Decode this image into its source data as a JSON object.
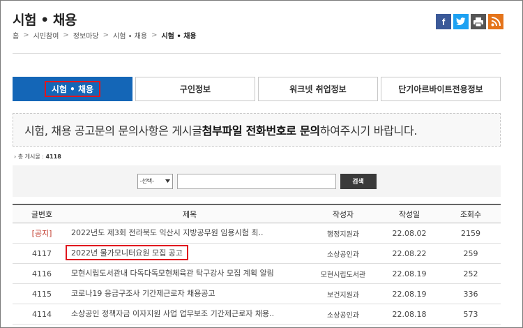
{
  "page": {
    "title": "시험 • 채용"
  },
  "share": {
    "facebook": "f",
    "twitter": "t",
    "print": "⎙",
    "rss": "⌁"
  },
  "breadcrumb": {
    "home": "홈",
    "items": [
      "시민참여",
      "정보마당",
      "시험 • 채용"
    ],
    "current": "시험 • 채용",
    "separator": ">"
  },
  "tabs": [
    {
      "label": "시험 • 채용",
      "active": true
    },
    {
      "label": "구인정보",
      "active": false
    },
    {
      "label": "워크넷 취업정보",
      "active": false
    },
    {
      "label": "단기아르바이트전용정보",
      "active": false
    }
  ],
  "notice": {
    "part1": "시험, 채용 공고문의 문의사항은 게시글 ",
    "bold": "첨부파일 전화번호로 문의",
    "part2": "하여주시기 바랍니다."
  },
  "total": {
    "label": "총 게시물 : ",
    "count": "4118"
  },
  "search": {
    "select_value": "-선택-",
    "input_value": "",
    "button": "검색"
  },
  "table": {
    "headers": {
      "no": "글번호",
      "title": "제목",
      "author": "작성자",
      "date": "작성일",
      "views": "조회수"
    },
    "rows": [
      {
        "no": "[공지]",
        "title": "2022년도 제3회 전라북도 익산시 지방공무원 임용시험 최..",
        "author": "행정지원과",
        "date": "22.08.02",
        "views": "2159"
      },
      {
        "no": "4117",
        "title": "2022년 물가모니터요원 모집 공고",
        "author": "소상공인과",
        "date": "22.08.22",
        "views": "259"
      },
      {
        "no": "4116",
        "title": "모현시립도서관내 다독다독모현체육관 탁구강사 모집 계획 알림",
        "author": "모현시립도서관",
        "date": "22.08.19",
        "views": "252"
      },
      {
        "no": "4115",
        "title": "코로나19 응급구조사 기간제근로자 채용공고",
        "author": "보건지원과",
        "date": "22.08.19",
        "views": "336"
      },
      {
        "no": "4114",
        "title": "소상공인 정책자금 이자지원 사업 업무보조 기간제근로자 채용..",
        "author": "소상공인과",
        "date": "22.08.18",
        "views": "573"
      }
    ]
  },
  "colors": {
    "accent": "#1466b7",
    "highlight": "#e0161e",
    "notice_tag": "#c0392b"
  }
}
